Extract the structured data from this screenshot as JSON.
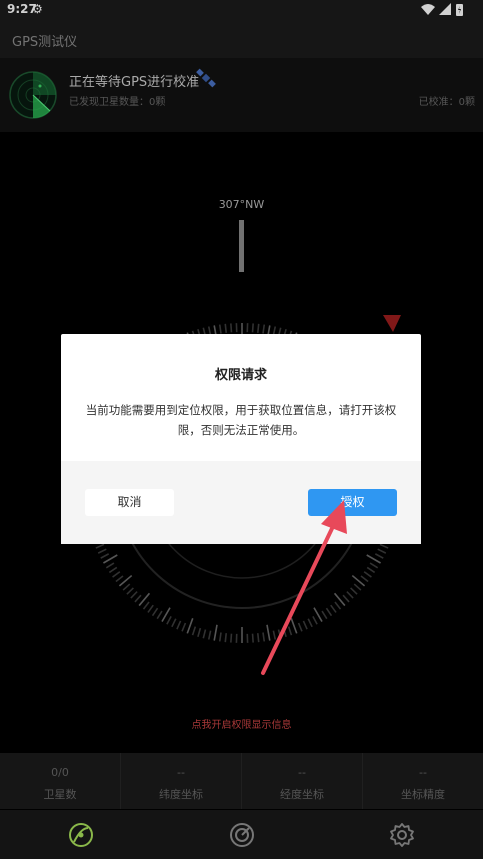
{
  "status": {
    "time": "9:27"
  },
  "app": {
    "title": "GPS测试仪"
  },
  "gps": {
    "title": "正在等待GPS进行校准",
    "satellites_found": "已发现卫星数量：0颗",
    "calibrated": "已校准：0颗"
  },
  "compass": {
    "heading": "307°NW",
    "marker_color": "#9e1e1e"
  },
  "dialog": {
    "title": "权限请求",
    "message": "当前功能需要用到定位权限，用于获取位置信息，请打开该权限，否则无法正常使用。",
    "cancel_label": "取消",
    "grant_label": "授权",
    "grant_color": "#2f97f2"
  },
  "hint": "点我开启权限显示信息",
  "stats": [
    {
      "value": "0/0",
      "label": "卫星数"
    },
    {
      "value": "--",
      "label": "纬度坐标"
    },
    {
      "value": "--",
      "label": "经度坐标"
    },
    {
      "value": "--",
      "label": "坐标精度"
    }
  ],
  "nav": {
    "items": [
      {
        "icon": "satellite-radar-icon"
      },
      {
        "icon": "compass-icon"
      },
      {
        "icon": "gear-icon"
      }
    ],
    "active_color": "#8ab84a"
  },
  "annotation": {
    "arrow_color": "#e8495a"
  }
}
